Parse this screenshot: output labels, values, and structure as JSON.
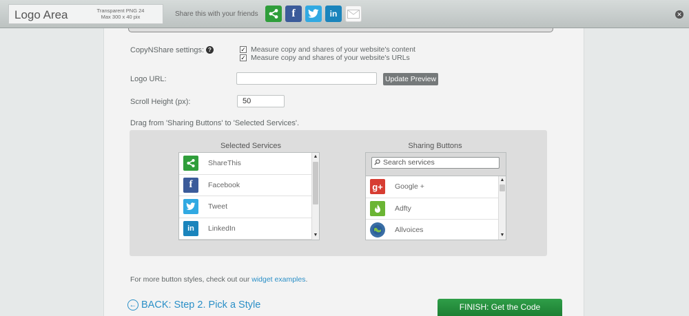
{
  "topbar": {
    "logo_text": "Logo Area",
    "logo_note_line1": "Transparent PNG 24",
    "logo_note_line2": "Max 300 x 40 pix",
    "share_text": "Share this with your friends"
  },
  "settings": {
    "copynshare_label": "CopyNShare settings:",
    "copynshare_options": [
      "Measure copy and shares of your website's content",
      "Measure copy and shares of your website's URLs"
    ],
    "logo_url_label": "Logo URL:",
    "logo_url_value": "",
    "update_preview_label": "Update Preview",
    "scroll_height_label": "Scroll Height (px):",
    "scroll_height_value": "50",
    "drag_instruction": "Drag from 'Sharing Buttons' to 'Selected Services'."
  },
  "selected_services": {
    "title": "Selected Services",
    "items": [
      {
        "label": "ShareThis",
        "icon": "sharethis-icon"
      },
      {
        "label": "Facebook",
        "icon": "facebook-icon"
      },
      {
        "label": "Tweet",
        "icon": "twitter-icon"
      },
      {
        "label": "LinkedIn",
        "icon": "linkedin-icon"
      }
    ]
  },
  "sharing_buttons": {
    "title": "Sharing Buttons",
    "search_placeholder": "Search services",
    "items": [
      {
        "label": "Google +",
        "icon": "google-plus-icon"
      },
      {
        "label": "Adfty",
        "icon": "adfty-icon"
      },
      {
        "label": "Allvoices",
        "icon": "allvoices-icon"
      }
    ]
  },
  "footer": {
    "more_styles_text": "For more button styles, check out our ",
    "widget_examples_link": "widget examples",
    "more_styles_end": ".",
    "back_label": "BACK: Step 2. Pick a Style",
    "finish_label": "FINISH: Get the Code"
  },
  "colors": {
    "accent_green": "#2f9e48",
    "link_blue": "#2a8fc7"
  }
}
